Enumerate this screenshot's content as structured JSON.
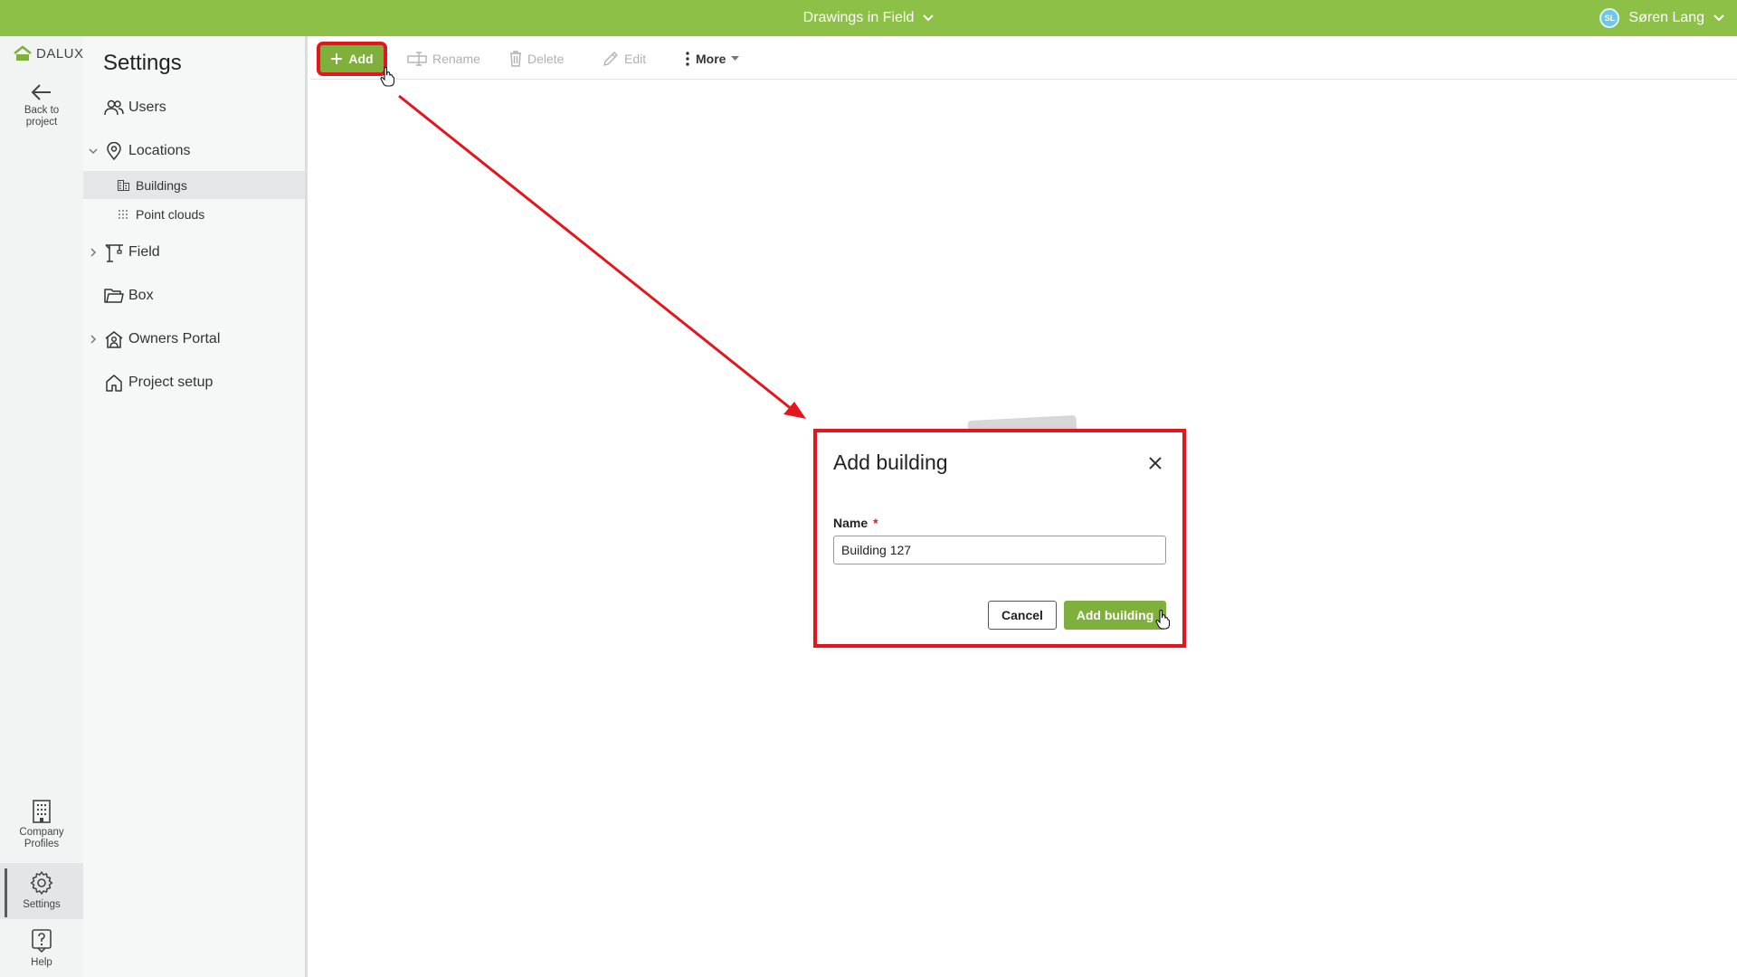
{
  "topbar": {
    "project_name": "Drawings in Field",
    "user_initials": "SL",
    "user_name": "Søren Lang"
  },
  "rail": {
    "logo_text": "DALUX",
    "back_label_1": "Back to",
    "back_label_2": "project",
    "company_label_1": "Company",
    "company_label_2": "Profiles",
    "settings_label": "Settings",
    "help_label": "Help"
  },
  "sidebar": {
    "title": "Settings",
    "items": [
      {
        "label": "Users",
        "icon": "users-icon"
      },
      {
        "label": "Locations",
        "icon": "location-pin-icon",
        "expanded": true
      },
      {
        "label": "Buildings",
        "icon": "building-icon",
        "active": true
      },
      {
        "label": "Point clouds",
        "icon": "point-cloud-icon"
      },
      {
        "label": "Field",
        "icon": "crane-icon",
        "expanded": false
      },
      {
        "label": "Box",
        "icon": "folder-icon"
      },
      {
        "label": "Owners Portal",
        "icon": "house-user-icon",
        "expanded": false
      },
      {
        "label": "Project setup",
        "icon": "home-icon"
      }
    ]
  },
  "toolbar": {
    "add": "Add",
    "rename": "Rename",
    "delete": "Delete",
    "edit": "Edit",
    "more": "More"
  },
  "dialog": {
    "title": "Add building",
    "name_label": "Name",
    "required_mark": "*",
    "name_value": "Building 127",
    "cancel_label": "Cancel",
    "submit_label": "Add building"
  },
  "colors": {
    "brand_green": "#8dc046",
    "button_green": "#7eb03b",
    "highlight_red": "#e4161d"
  }
}
